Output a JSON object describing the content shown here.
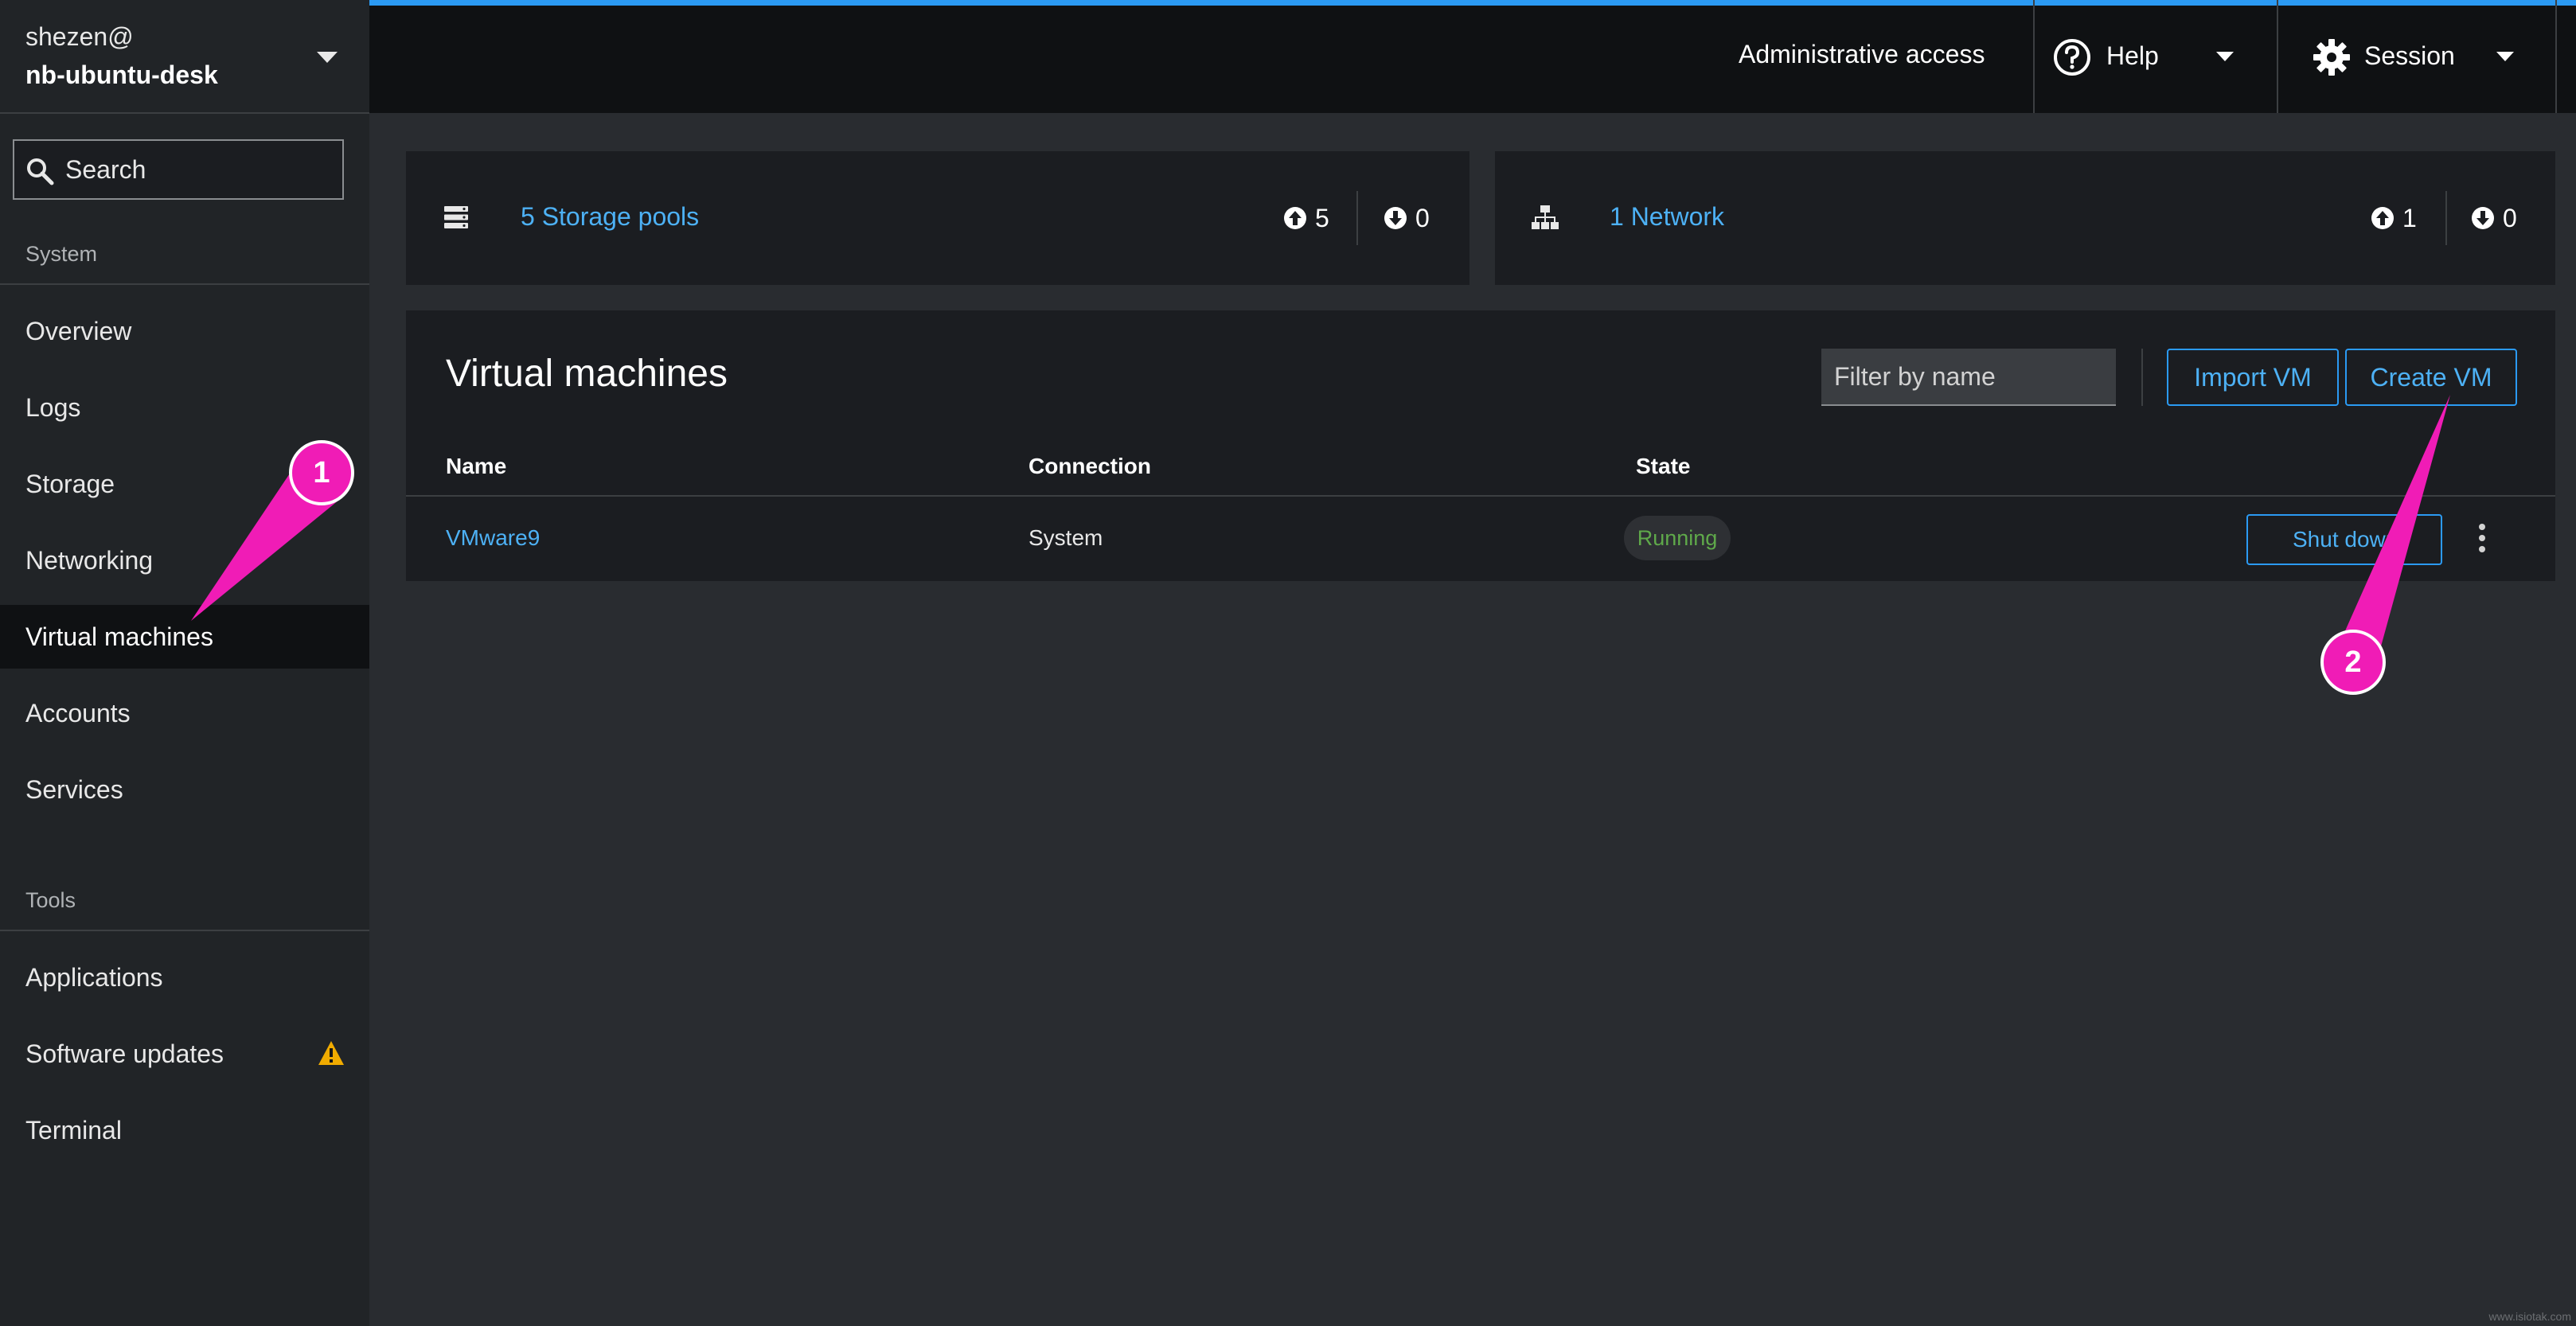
{
  "sidebar": {
    "host_user": "shezen@",
    "host_name": "nb-ubuntu-desk",
    "search_placeholder": "Search",
    "sections": {
      "system": "System",
      "tools": "Tools"
    },
    "system_items": [
      "Overview",
      "Logs",
      "Storage",
      "Networking",
      "Virtual machines",
      "Accounts",
      "Services"
    ],
    "tool_items": [
      "Applications",
      "Software updates",
      "Terminal"
    ],
    "active_item": "Virtual machines",
    "software_updates_badge": "warning-icon"
  },
  "topbar": {
    "admin_access": "Administrative access",
    "help_label": "Help",
    "session_label": "Session",
    "accent_color": "#2b9af3"
  },
  "summary": {
    "storage": {
      "link": "5 Storage pools",
      "up": "5",
      "down": "0",
      "icon": "storage-icon"
    },
    "network": {
      "link": "1 Network",
      "up": "1",
      "down": "0",
      "icon": "network-icon"
    }
  },
  "vm_panel": {
    "title": "Virtual machines",
    "filter_placeholder": "Filter by name",
    "import_label": "Import VM",
    "create_label": "Create VM",
    "columns": [
      "Name",
      "Connection",
      "State"
    ],
    "rows": [
      {
        "name": "VMware9",
        "connection": "System",
        "state": "Running",
        "action": "Shut down"
      }
    ],
    "link_color": "#4db1f5",
    "running_color": "#5fa94a"
  },
  "annotations": {
    "callout_1": "1",
    "callout_2": "2",
    "color": "#f01cb6"
  },
  "watermark": "www.isiotak.com"
}
